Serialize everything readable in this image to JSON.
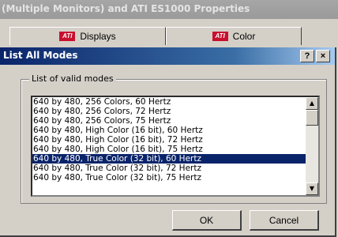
{
  "background_window": {
    "title": "(Multiple Monitors) and ATI ES1000  Properties",
    "tabs": [
      {
        "label": "Displays",
        "icon": "ati-logo-icon"
      },
      {
        "label": "Color",
        "icon": "ati-logo-icon"
      }
    ],
    "ati_badge": "ATI"
  },
  "dialog": {
    "title": "List All Modes",
    "help_button": "?",
    "close_button": "×",
    "group_label": "List of valid modes",
    "modes": [
      "640 by 480, 256 Colors, 60 Hertz",
      "640 by 480, 256 Colors, 72 Hertz",
      "640 by 480, 256 Colors, 75 Hertz",
      "640 by 480, High Color (16 bit), 60 Hertz",
      "640 by 480, High Color (16 bit), 72 Hertz",
      "640 by 480, High Color (16 bit), 75 Hertz",
      "640 by 480, True Color (32 bit), 60 Hertz",
      "640 by 480, True Color (32 bit), 72 Hertz",
      "640 by 480, True Color (32 bit), 75 Hertz"
    ],
    "selected_index": 6,
    "ok_label": "OK",
    "cancel_label": "Cancel"
  },
  "colors": {
    "selection": "#0a246a",
    "titlebar_active": "#0a246a",
    "face": "#d4d0c8"
  }
}
